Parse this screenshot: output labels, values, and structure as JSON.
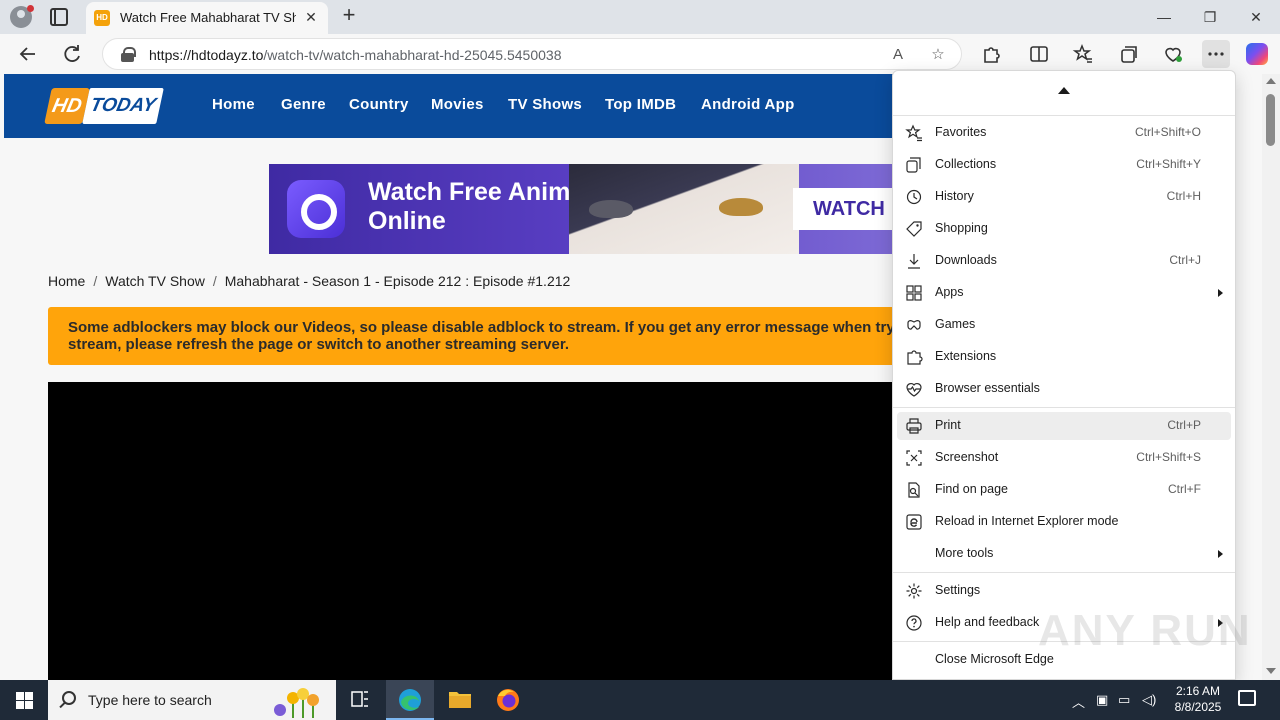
{
  "browser": {
    "tab_title": "Watch Free Mahabharat TV Show",
    "tab_favicon": "HD",
    "url_host": "https://hdtodayz.to",
    "url_path": "/watch-tv/watch-mahabharat-hd-25045.5450038"
  },
  "site": {
    "logo_hd": "HD",
    "logo_today": "TODAY",
    "nav": [
      "Home",
      "Genre",
      "Country",
      "Movies",
      "TV Shows",
      "Top IMDB",
      "Android App"
    ],
    "banner_headline": "Watch Free Anime Online",
    "banner_cta": "WATCH",
    "breadcrumb": [
      "Home",
      "Watch TV Show",
      "Mahabharat - Season 1 - Episode 212 : Episode #1.212"
    ],
    "notice": "Some adblockers may block our Videos, so please disable adblock to stream. If you get any error message when trying to stream, please refresh the page or switch to another streaming server."
  },
  "menu": {
    "items": [
      {
        "label": "Favorites",
        "shortcut": "Ctrl+Shift+O",
        "icon": "favorites-icon"
      },
      {
        "label": "Collections",
        "shortcut": "Ctrl+Shift+Y",
        "icon": "collections-icon"
      },
      {
        "label": "History",
        "shortcut": "Ctrl+H",
        "icon": "history-icon"
      },
      {
        "label": "Shopping",
        "shortcut": "",
        "icon": "shopping-tag-icon"
      },
      {
        "label": "Downloads",
        "shortcut": "Ctrl+J",
        "icon": "download-icon"
      },
      {
        "label": "Apps",
        "shortcut": "",
        "icon": "apps-icon"
      },
      {
        "label": "Games",
        "shortcut": "",
        "icon": "games-icon"
      },
      {
        "label": "Extensions",
        "shortcut": "",
        "icon": "puzzle-icon"
      },
      {
        "label": "Browser essentials",
        "shortcut": "",
        "icon": "heart-pulse-icon"
      },
      {
        "label": "Print",
        "shortcut": "Ctrl+P",
        "icon": "printer-icon"
      },
      {
        "label": "Screenshot",
        "shortcut": "Ctrl+Shift+S",
        "icon": "screenshot-icon"
      },
      {
        "label": "Find on page",
        "shortcut": "Ctrl+F",
        "icon": "find-icon"
      },
      {
        "label": "Reload in Internet Explorer mode",
        "shortcut": "",
        "icon": "ie-mode-icon"
      },
      {
        "label": "More tools",
        "shortcut": "",
        "icon": ""
      },
      {
        "label": "Settings",
        "shortcut": "",
        "icon": "gear-icon"
      },
      {
        "label": "Help and feedback",
        "shortcut": "",
        "icon": "help-icon"
      },
      {
        "label": "Close Microsoft Edge",
        "shortcut": "",
        "icon": ""
      }
    ],
    "hovered": "Print"
  },
  "watermark": "ANY RUN",
  "taskbar": {
    "search_placeholder": "Type here to search",
    "time": "2:16 AM",
    "date": "8/8/2025"
  },
  "colors": {
    "site_header": "#0a4b9b",
    "notice_bg": "#ffa40b",
    "logo_orange": "#f49a1a"
  }
}
